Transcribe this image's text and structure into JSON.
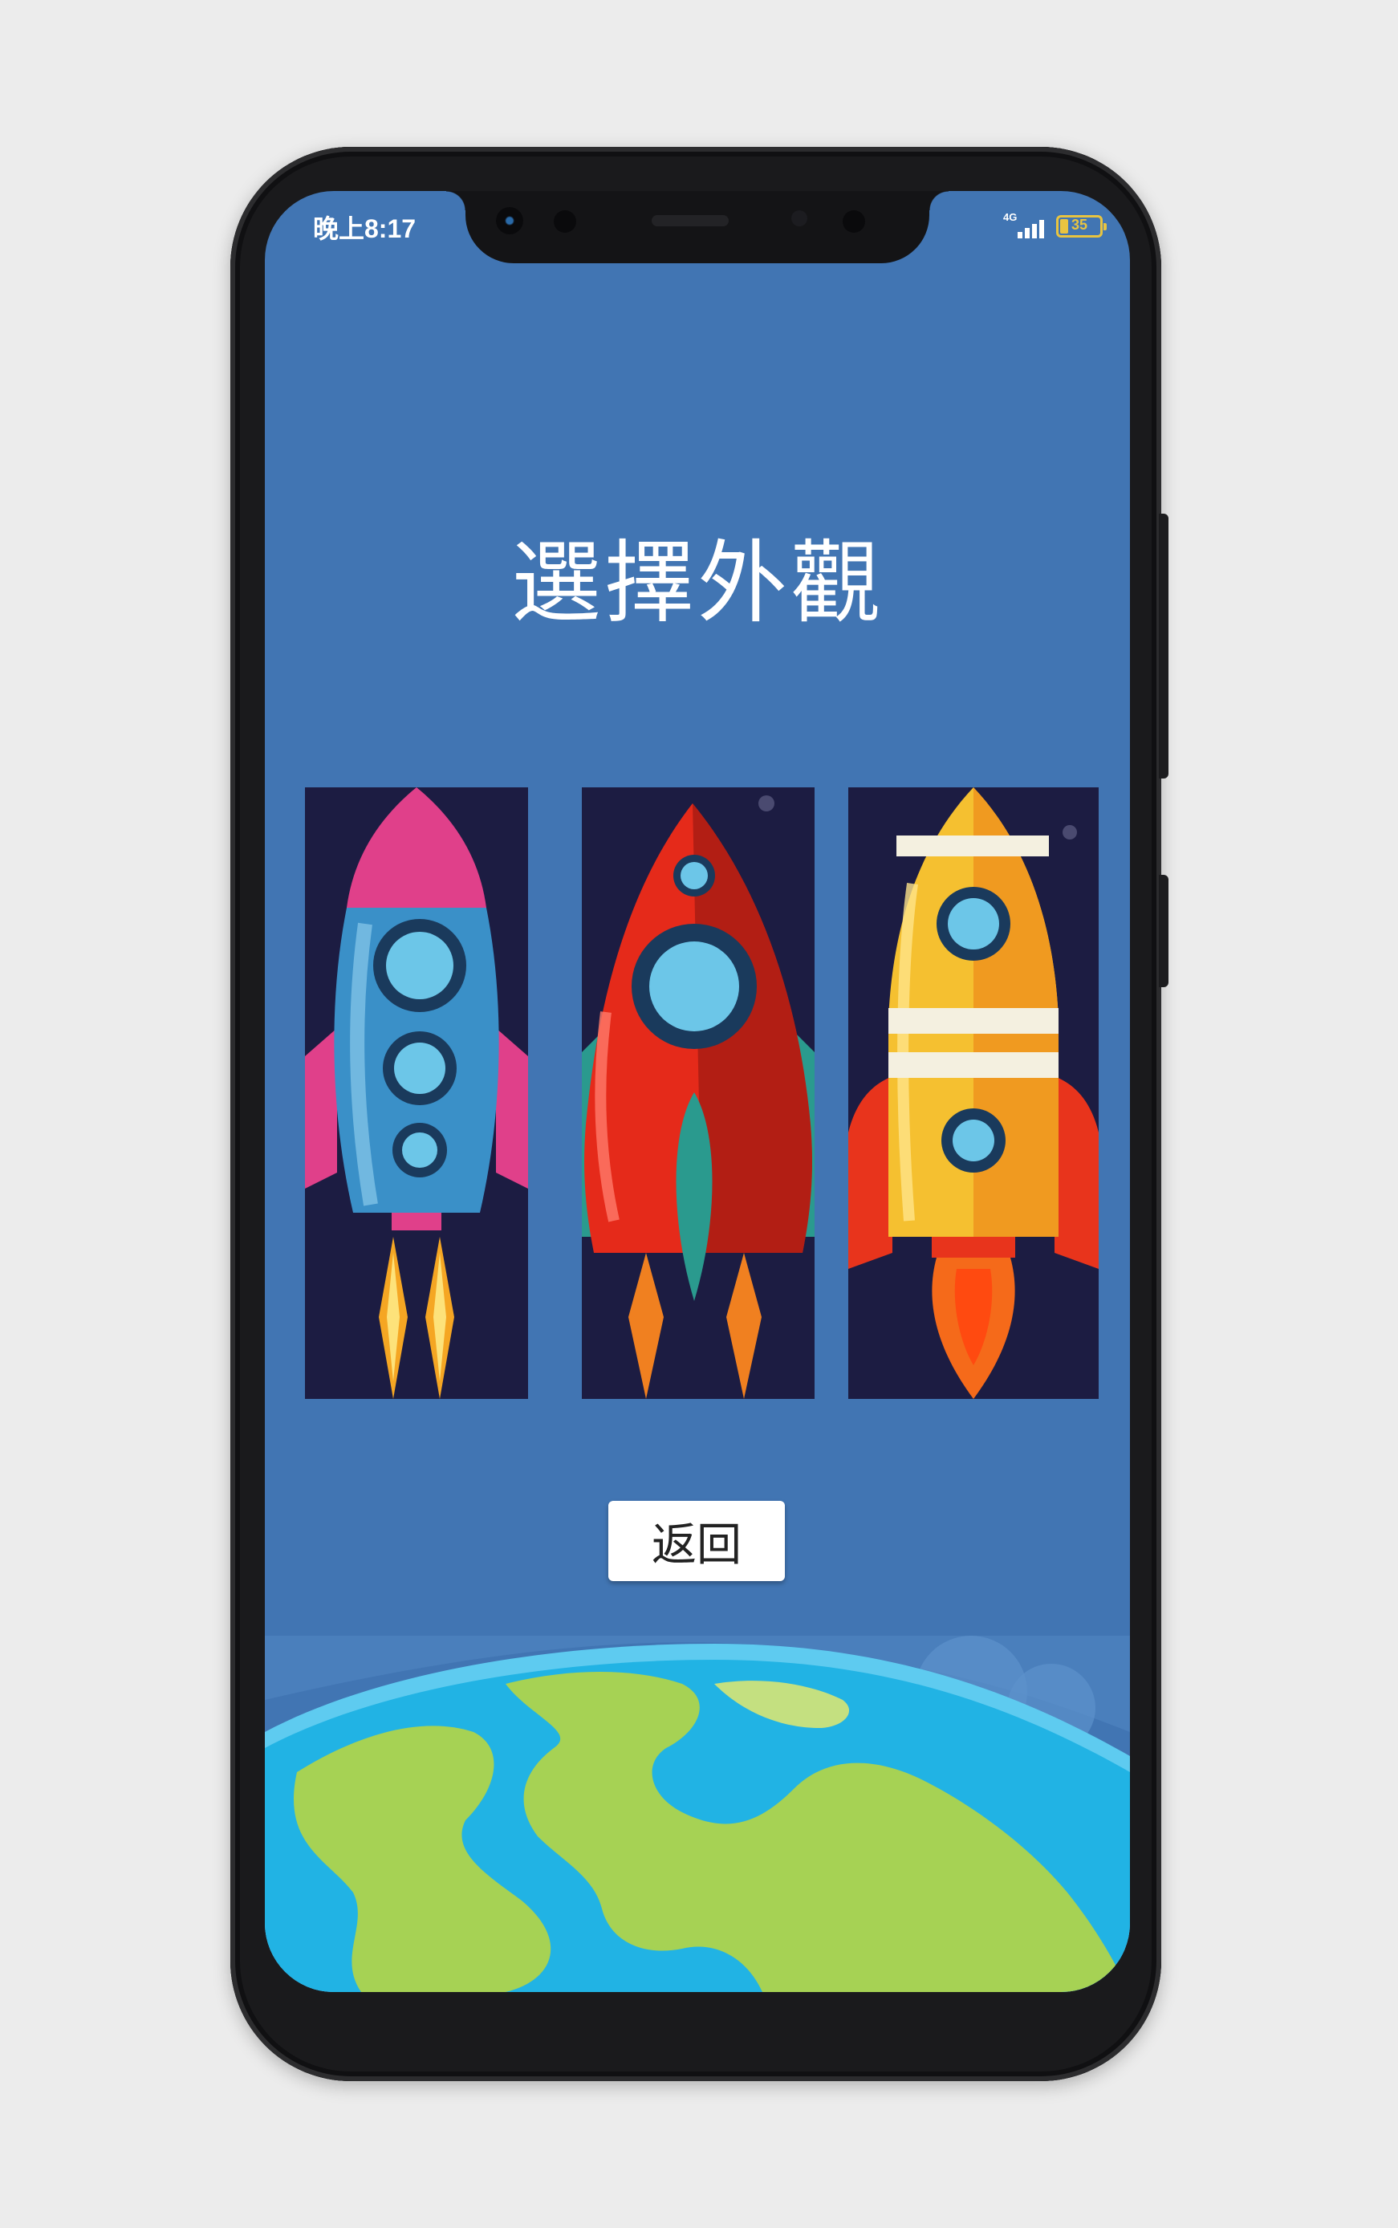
{
  "status_bar": {
    "time": "晚上8:17",
    "network": "4G",
    "battery_level": "35",
    "battery_color": "#e8c440"
  },
  "screen": {
    "title": "選擇外觀",
    "background_color": "#4175b3"
  },
  "skins": [
    {
      "name": "blue-pink-rocket",
      "body_color": "#3a90c8",
      "accent_color": "#e0408a"
    },
    {
      "name": "red-rocket",
      "body_color": "#e52a1a",
      "accent_color": "#2a9a8e"
    },
    {
      "name": "yellow-orange-rocket",
      "body_color": "#f5c030",
      "accent_color": "#e8341c"
    }
  ],
  "back_button": {
    "label": "返回"
  }
}
